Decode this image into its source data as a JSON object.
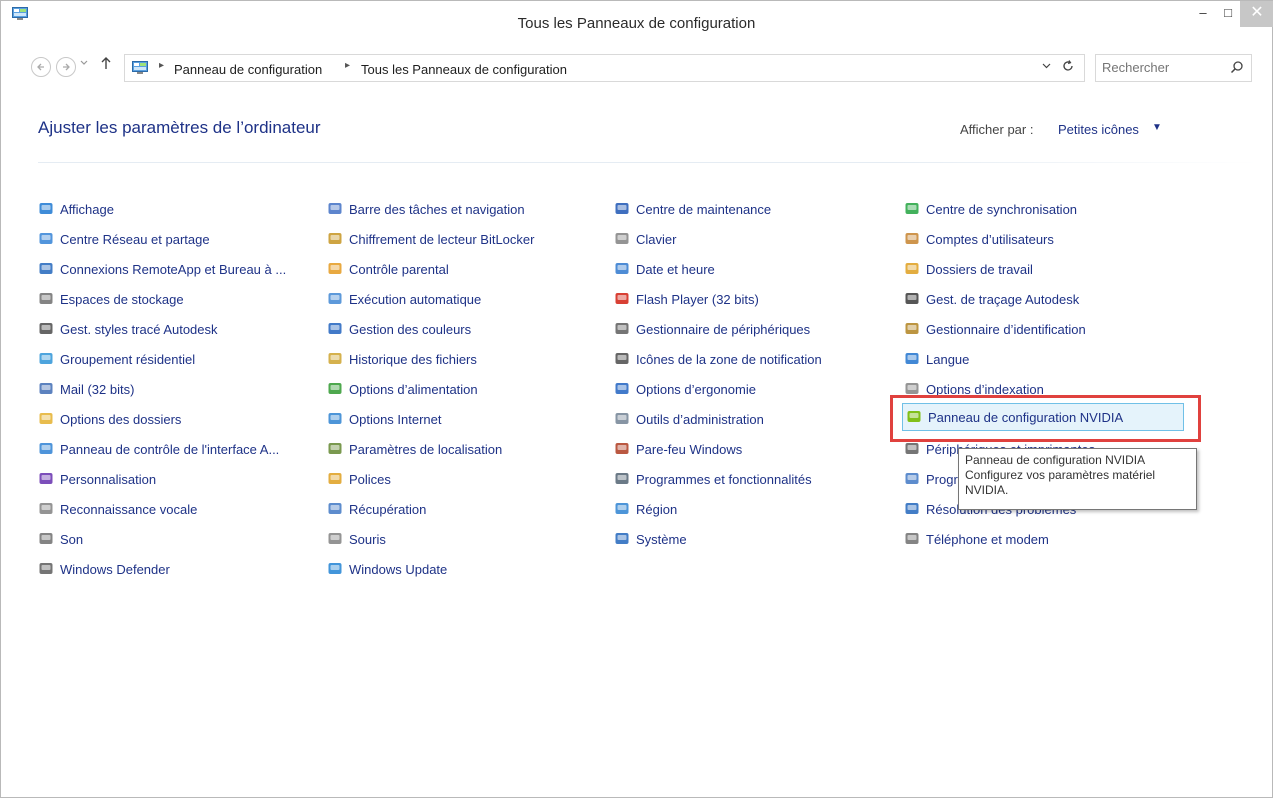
{
  "window": {
    "title": "Tous les Panneaux de configuration",
    "minimize_label": "–",
    "maximize_label": "□",
    "close_label": "✕"
  },
  "address": {
    "crumbs": [
      "Panneau de configuration",
      "Tous les Panneaux de configuration"
    ],
    "search_placeholder": "Rechercher"
  },
  "header": {
    "title": "Ajuster les paramètres de l’ordinateur",
    "view_label": "Afficher par :",
    "view_value": "Petites icônes"
  },
  "columns": [
    [
      {
        "label": "Affichage",
        "icon": "display-icon"
      },
      {
        "label": "Centre Réseau et partage",
        "icon": "network-icon"
      },
      {
        "label": "Connexions RemoteApp et Bureau à ...",
        "icon": "remoteapp-icon"
      },
      {
        "label": "Espaces de stockage",
        "icon": "storage-icon"
      },
      {
        "label": "Gest. styles tracé Autodesk",
        "icon": "plot-style-icon"
      },
      {
        "label": "Groupement résidentiel",
        "icon": "homegroup-icon"
      },
      {
        "label": "Mail (32 bits)",
        "icon": "mail-icon"
      },
      {
        "label": "Options des dossiers",
        "icon": "folder-options-icon"
      },
      {
        "label": "Panneau de contrôle de l'interface A...",
        "icon": "interface-panel-icon"
      },
      {
        "label": "Personnalisation",
        "icon": "personalization-icon"
      },
      {
        "label": "Reconnaissance vocale",
        "icon": "microphone-icon"
      },
      {
        "label": "Son",
        "icon": "speaker-icon"
      },
      {
        "label": "Windows Defender",
        "icon": "defender-icon"
      }
    ],
    [
      {
        "label": "Barre des tâches et navigation",
        "icon": "taskbar-icon"
      },
      {
        "label": "Chiffrement de lecteur BitLocker",
        "icon": "bitlocker-icon"
      },
      {
        "label": "Contrôle parental",
        "icon": "parental-icon"
      },
      {
        "label": "Exécution automatique",
        "icon": "autoplay-icon"
      },
      {
        "label": "Gestion des couleurs",
        "icon": "color-management-icon"
      },
      {
        "label": "Historique des fichiers",
        "icon": "file-history-icon"
      },
      {
        "label": "Options d’alimentation",
        "icon": "power-icon"
      },
      {
        "label": "Options Internet",
        "icon": "internet-options-icon"
      },
      {
        "label": "Paramètres de localisation",
        "icon": "location-icon"
      },
      {
        "label": "Polices",
        "icon": "fonts-icon"
      },
      {
        "label": "Récupération",
        "icon": "recovery-icon"
      },
      {
        "label": "Souris",
        "icon": "mouse-icon"
      },
      {
        "label": "Windows Update",
        "icon": "update-icon"
      }
    ],
    [
      {
        "label": "Centre de maintenance",
        "icon": "flag-icon"
      },
      {
        "label": "Clavier",
        "icon": "keyboard-icon"
      },
      {
        "label": "Date et heure",
        "icon": "clock-icon"
      },
      {
        "label": "Flash Player (32 bits)",
        "icon": "flash-icon"
      },
      {
        "label": "Gestionnaire de périphériques",
        "icon": "device-manager-icon"
      },
      {
        "label": "Icônes de la zone de notification",
        "icon": "notification-icon"
      },
      {
        "label": "Options d’ergonomie",
        "icon": "ease-of-access-icon"
      },
      {
        "label": "Outils d’administration",
        "icon": "admin-tools-icon"
      },
      {
        "label": "Pare-feu Windows",
        "icon": "firewall-icon"
      },
      {
        "label": "Programmes et fonctionnalités",
        "icon": "programs-icon"
      },
      {
        "label": "Région",
        "icon": "region-icon"
      },
      {
        "label": "Système",
        "icon": "system-icon"
      }
    ],
    [
      {
        "label": "Centre de synchronisation",
        "icon": "sync-icon"
      },
      {
        "label": "Comptes d’utilisateurs",
        "icon": "users-icon"
      },
      {
        "label": "Dossiers de travail",
        "icon": "work-folders-icon"
      },
      {
        "label": "Gest. de traçage Autodesk",
        "icon": "plotter-icon"
      },
      {
        "label": "Gestionnaire d’identification",
        "icon": "credential-icon"
      },
      {
        "label": "Langue",
        "icon": "language-icon"
      },
      {
        "label": "Options d’indexation",
        "icon": "indexing-icon"
      },
      {
        "label": "Panneau de configuration NVIDIA",
        "icon": "nvidia-icon"
      },
      {
        "label": "Périphériques et imprimantes",
        "icon": "devices-printers-icon"
      },
      {
        "label": "Programmes par défaut",
        "icon": "default-programs-icon"
      },
      {
        "label": "Résolution des problèmes",
        "icon": "troubleshoot-icon"
      },
      {
        "label": "Téléphone et modem",
        "icon": "phone-modem-icon"
      }
    ]
  ],
  "tooltip": {
    "line1": "Panneau de configuration NVIDIA",
    "line2": "Configurez vos paramètres matériel",
    "line3": "NVIDIA."
  }
}
